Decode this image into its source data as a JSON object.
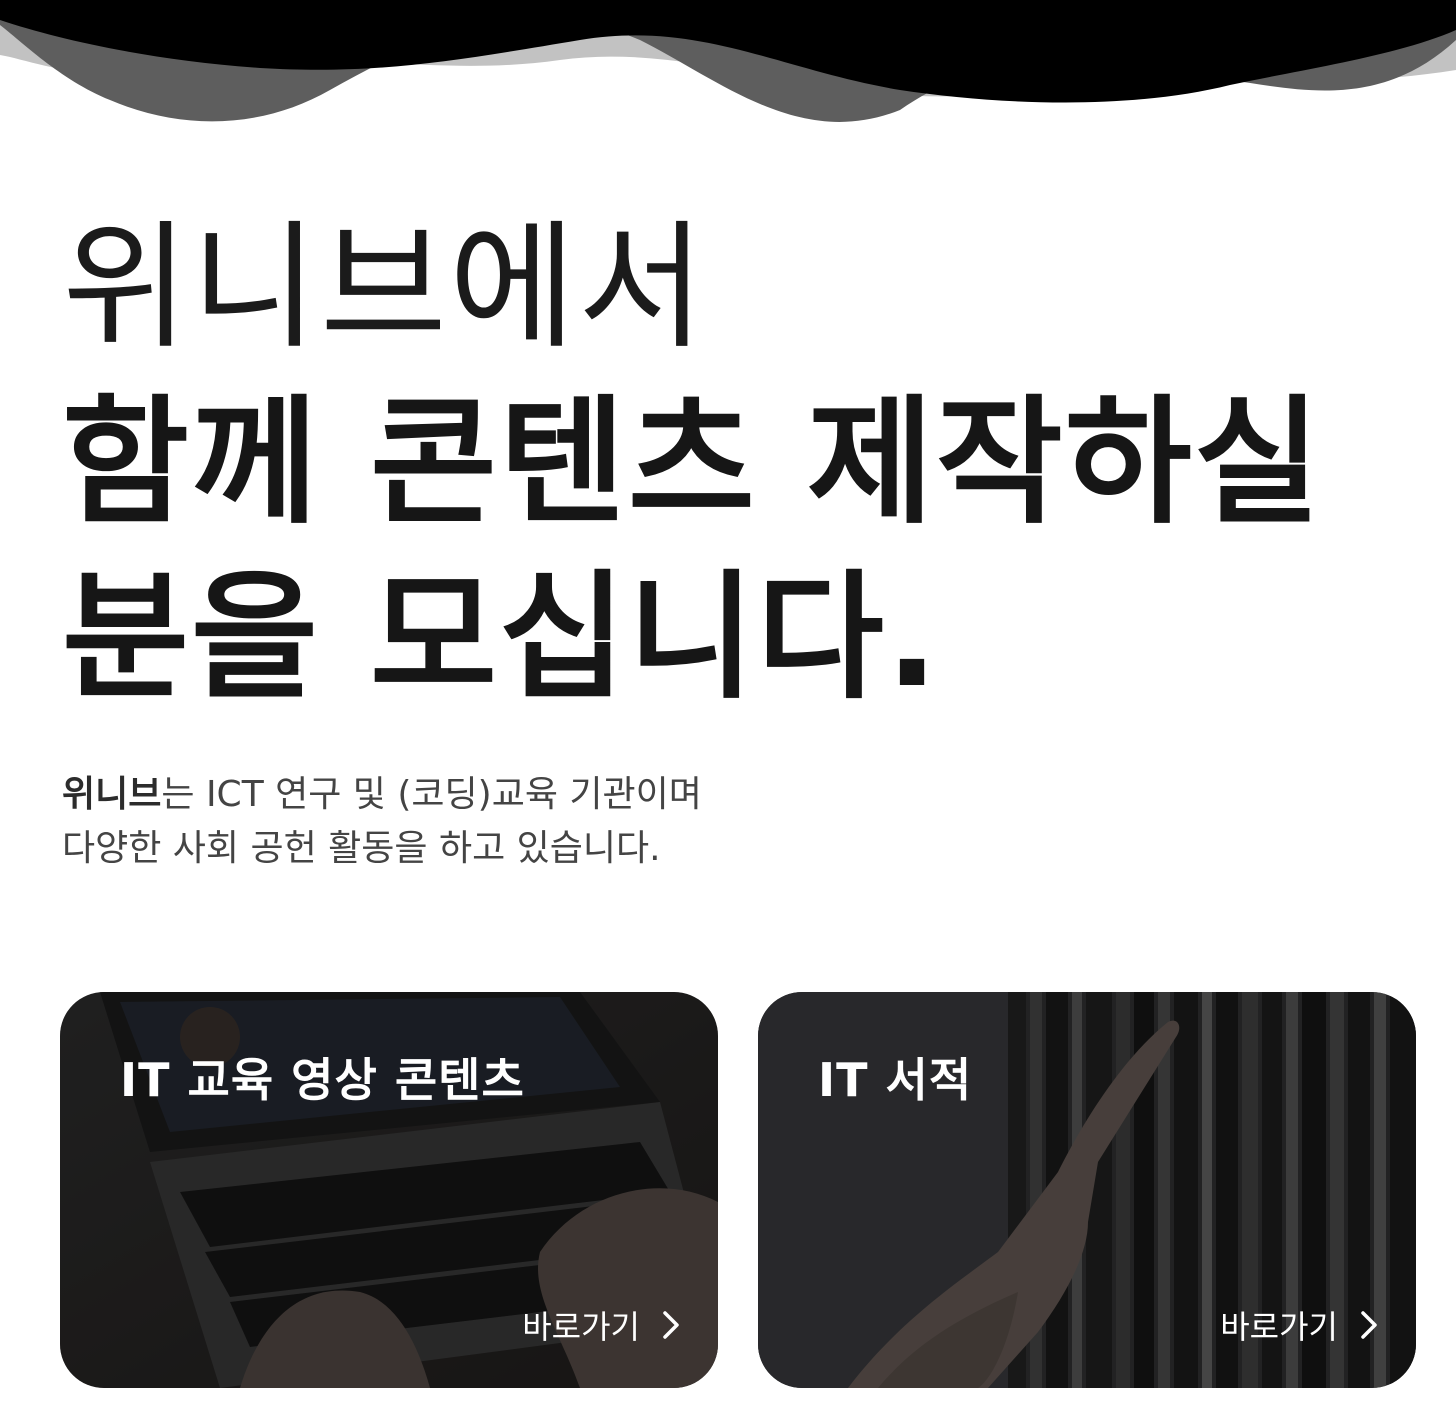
{
  "header": {
    "wave_colors": [
      "#000000",
      "#5e5e5e",
      "#bcbcbc"
    ]
  },
  "hero": {
    "line_light": "위니브에서",
    "line_bold_1": "함께 콘텐츠 제작하실",
    "line_bold_2": "분을 모십니다."
  },
  "intro": {
    "brand": "위니브",
    "line1_rest": "는 ICT 연구 및 (코딩)교육 기관이며",
    "line2": "다양한 사회 공헌 활동을 하고 있습니다."
  },
  "cards": [
    {
      "title": "IT 교육 영상 콘텐츠",
      "link_label": "바로가기",
      "icon": "chevron-right-icon",
      "image": "laptop-typing-photo"
    },
    {
      "title": "IT 서적",
      "link_label": "바로가기",
      "icon": "chevron-right-icon",
      "image": "bookshelf-hand-photo"
    }
  ]
}
